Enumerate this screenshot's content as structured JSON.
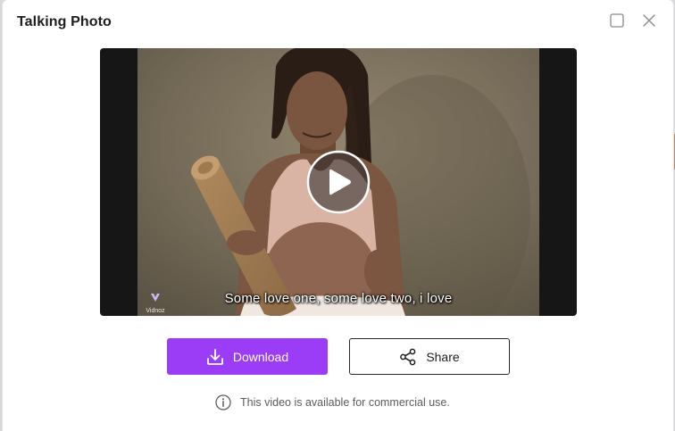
{
  "dialog": {
    "title": "Talking Photo"
  },
  "window_controls": {
    "maximize_icon": "maximize-square-icon",
    "close_icon": "close-x-icon"
  },
  "video": {
    "subtitle": "Some love one, some love two, i love",
    "watermark": "Vidnoz",
    "play_icon": "play-icon"
  },
  "actions": {
    "download_label": "Download",
    "download_icon": "download-icon",
    "share_label": "Share",
    "share_icon": "share-icon"
  },
  "notice": {
    "text": "This video is available for commercial use.",
    "icon": "info-icon"
  },
  "colors": {
    "accent": "#9b3cf6",
    "title_text": "#1d1d1f",
    "muted_text": "#5b5b60",
    "video_letterbox": "#161617"
  }
}
